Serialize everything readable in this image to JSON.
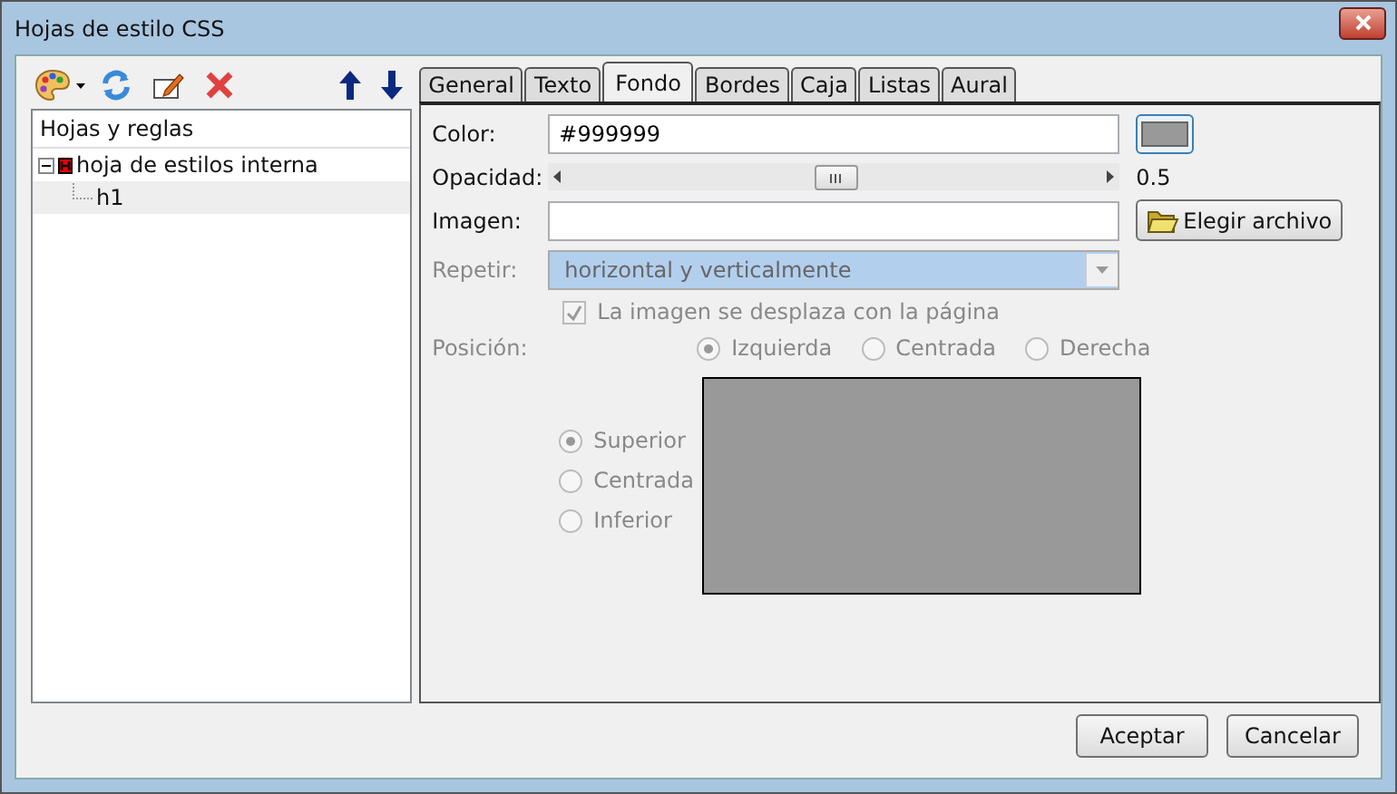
{
  "window": {
    "title": "Hojas de estilo CSS"
  },
  "toolbar": {
    "left": [
      {
        "kind": "palette",
        "dropdown": true
      },
      {
        "kind": "refresh",
        "dropdown": false
      },
      {
        "kind": "edit",
        "dropdown": false
      },
      {
        "kind": "delete",
        "dropdown": false
      }
    ],
    "right": [
      {
        "kind": "up"
      },
      {
        "kind": "down"
      }
    ]
  },
  "tree": {
    "header": "Hojas y reglas",
    "items": [
      {
        "label": "hoja de estilos interna",
        "expanded": true,
        "selected": false,
        "children": [
          {
            "label": "h1",
            "selected": true
          }
        ]
      }
    ]
  },
  "tabs": [
    {
      "label": "General",
      "selected": false
    },
    {
      "label": "Texto",
      "selected": false
    },
    {
      "label": "Fondo",
      "selected": true
    },
    {
      "label": "Bordes",
      "selected": false
    },
    {
      "label": "Caja",
      "selected": false
    },
    {
      "label": "Listas",
      "selected": false
    },
    {
      "label": "Aural",
      "selected": false
    }
  ],
  "background": {
    "color": {
      "label": "Color:",
      "value": "#999999"
    },
    "opacity": {
      "label": "Opacidad:",
      "level": 0.5,
      "reading": "0.5"
    },
    "image": {
      "label": "Imagen:",
      "button": "Elegir archivo"
    },
    "repeat": {
      "label": "Repetir:",
      "value": "horizontal y verticalmente",
      "disabled": true
    },
    "scroll": {
      "label": "La imagen se desplaza con la página",
      "checked": true,
      "disabled": true
    },
    "position": {
      "label": "Posición:",
      "disabled": true,
      "horizontal": [
        {
          "label": "Izquierda",
          "selected": true
        },
        {
          "label": "Centrada",
          "selected": false
        },
        {
          "label": "Derecha",
          "selected": false
        }
      ],
      "vertical": [
        {
          "label": "Superior",
          "selected": true
        },
        {
          "label": "Centrada",
          "selected": false
        },
        {
          "label": "Inferior",
          "selected": false
        }
      ]
    }
  },
  "buttons": [
    "Aceptar",
    "Cancelar"
  ]
}
